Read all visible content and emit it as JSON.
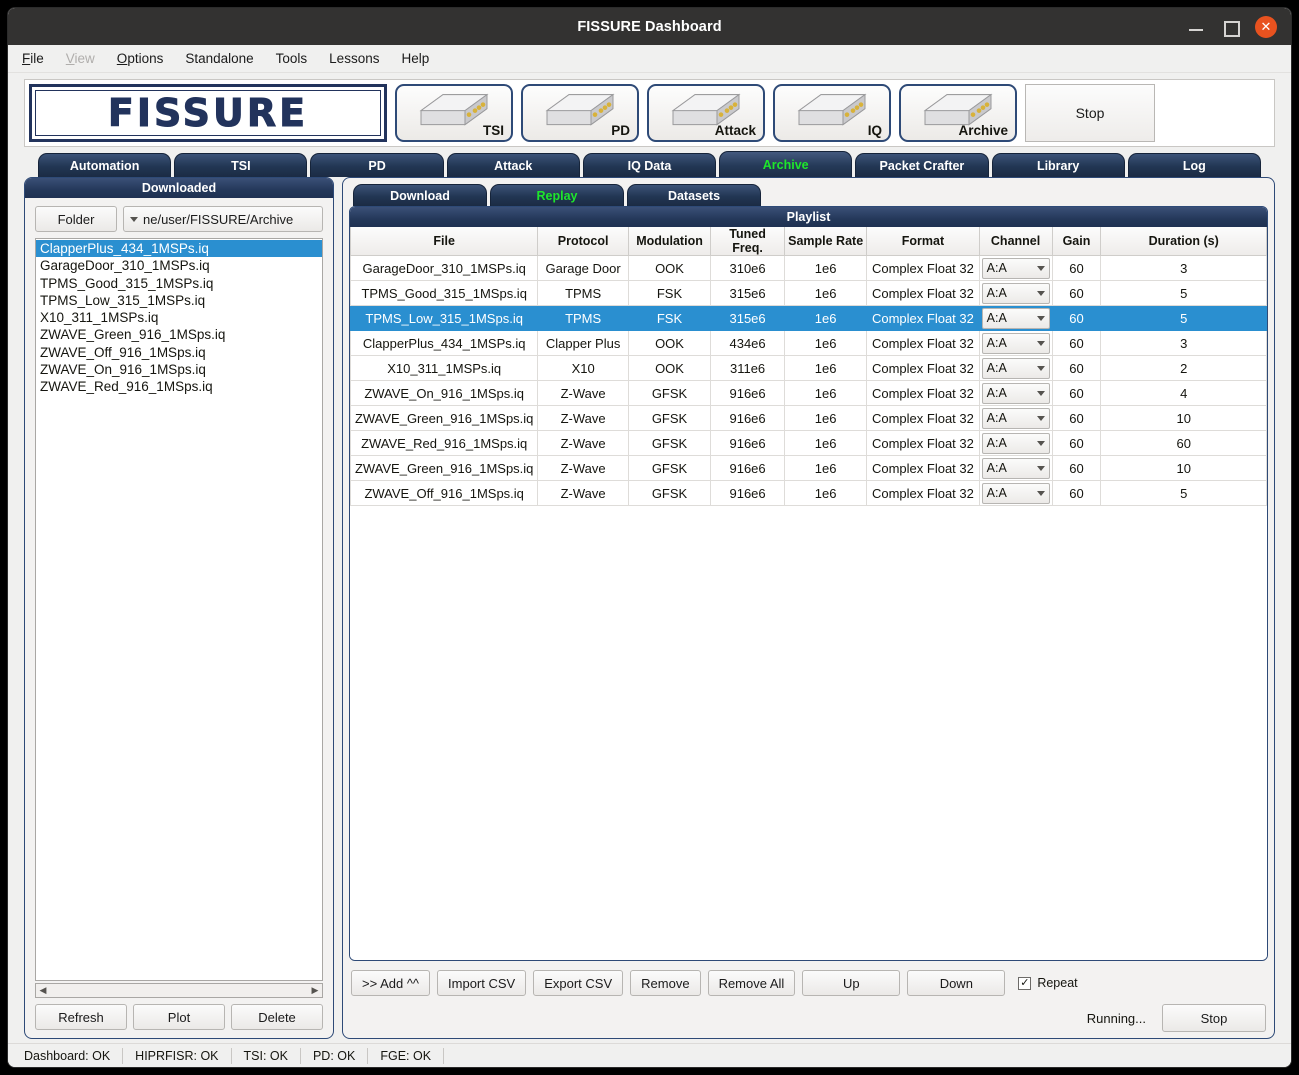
{
  "window": {
    "title": "FISSURE Dashboard",
    "minimize_icon": "minimize-icon",
    "maximize_icon": "maximize-icon",
    "close_icon": "close-icon",
    "close_glyph": "✕"
  },
  "menubar": {
    "items": [
      {
        "label": "File",
        "mnemonic": "F",
        "disabled": false
      },
      {
        "label": "View",
        "mnemonic": "V",
        "disabled": true
      },
      {
        "label": "Options",
        "mnemonic": "O",
        "disabled": false
      },
      {
        "label": "Standalone",
        "mnemonic": "",
        "disabled": false
      },
      {
        "label": "Tools",
        "mnemonic": "",
        "disabled": false
      },
      {
        "label": "Lessons",
        "mnemonic": "",
        "disabled": false
      },
      {
        "label": "Help",
        "mnemonic": "",
        "disabled": false
      }
    ]
  },
  "toolbar": {
    "logo_text": "FISSURE",
    "devices": [
      {
        "label": "TSI",
        "icon": "sdr-device-icon"
      },
      {
        "label": "PD",
        "icon": "sdr-device-icon"
      },
      {
        "label": "Attack",
        "icon": "sdr-device-icon"
      },
      {
        "label": "IQ",
        "icon": "sdr-device-icon"
      },
      {
        "label": "Archive",
        "icon": "sdr-device-icon"
      }
    ],
    "stop_label": "Stop"
  },
  "main_tabs": {
    "active": "Archive",
    "items": [
      {
        "label": "Automation"
      },
      {
        "label": "TSI"
      },
      {
        "label": "PD"
      },
      {
        "label": "Attack"
      },
      {
        "label": "IQ Data"
      },
      {
        "label": "Archive"
      },
      {
        "label": "Packet Crafter"
      },
      {
        "label": "Library"
      },
      {
        "label": "Log"
      }
    ]
  },
  "downloaded_panel": {
    "header": "Downloaded",
    "folder_button": "Folder",
    "path_value": "ne/user/FISSURE/Archive",
    "files": [
      "ClapperPlus_434_1MSPs.iq",
      "GarageDoor_310_1MSPs.iq",
      "TPMS_Good_315_1MSPs.iq",
      "TPMS_Low_315_1MSPs.iq",
      "X10_311_1MSPs.iq",
      "ZWAVE_Green_916_1MSps.iq",
      "ZWAVE_Off_916_1MSps.iq",
      "ZWAVE_On_916_1MSps.iq",
      "ZWAVE_Red_916_1MSps.iq"
    ],
    "selected_index": 0,
    "buttons": [
      {
        "label": "Refresh"
      },
      {
        "label": "Plot"
      },
      {
        "label": "Delete"
      }
    ]
  },
  "sub_tabs": {
    "active": "Replay",
    "items": [
      {
        "label": "Download"
      },
      {
        "label": "Replay"
      },
      {
        "label": "Datasets"
      }
    ]
  },
  "playlist": {
    "header": "Playlist",
    "columns": [
      "File",
      "Protocol",
      "Modulation",
      "Tuned Freq.",
      "Sample Rate",
      "Format",
      "Channel",
      "Gain",
      "Duration (s)"
    ],
    "selected_index": 2,
    "rows": [
      {
        "file": "GarageDoor_310_1MSPs.iq",
        "protocol": "Garage Door",
        "modulation": "OOK",
        "tuned_freq": "310e6",
        "sample_rate": "1e6",
        "format": "Complex Float 32",
        "channel": "A:A",
        "gain": "60",
        "duration": "3"
      },
      {
        "file": "TPMS_Good_315_1MSps.iq",
        "protocol": "TPMS",
        "modulation": "FSK",
        "tuned_freq": "315e6",
        "sample_rate": "1e6",
        "format": "Complex Float 32",
        "channel": "A:A",
        "gain": "60",
        "duration": "5"
      },
      {
        "file": "TPMS_Low_315_1MSps.iq",
        "protocol": "TPMS",
        "modulation": "FSK",
        "tuned_freq": "315e6",
        "sample_rate": "1e6",
        "format": "Complex Float 32",
        "channel": "A:A",
        "gain": "60",
        "duration": "5"
      },
      {
        "file": "ClapperPlus_434_1MSPs.iq",
        "protocol": "Clapper Plus",
        "modulation": "OOK",
        "tuned_freq": "434e6",
        "sample_rate": "1e6",
        "format": "Complex Float 32",
        "channel": "A:A",
        "gain": "60",
        "duration": "3"
      },
      {
        "file": "X10_311_1MSPs.iq",
        "protocol": "X10",
        "modulation": "OOK",
        "tuned_freq": "311e6",
        "sample_rate": "1e6",
        "format": "Complex Float 32",
        "channel": "A:A",
        "gain": "60",
        "duration": "2"
      },
      {
        "file": "ZWAVE_On_916_1MSps.iq",
        "protocol": "Z-Wave",
        "modulation": "GFSK",
        "tuned_freq": "916e6",
        "sample_rate": "1e6",
        "format": "Complex Float 32",
        "channel": "A:A",
        "gain": "60",
        "duration": "4"
      },
      {
        "file": "ZWAVE_Green_916_1MSps.iq",
        "protocol": "Z-Wave",
        "modulation": "GFSK",
        "tuned_freq": "916e6",
        "sample_rate": "1e6",
        "format": "Complex Float 32",
        "channel": "A:A",
        "gain": "60",
        "duration": "10"
      },
      {
        "file": "ZWAVE_Red_916_1MSps.iq",
        "protocol": "Z-Wave",
        "modulation": "GFSK",
        "tuned_freq": "916e6",
        "sample_rate": "1e6",
        "format": "Complex Float 32",
        "channel": "A:A",
        "gain": "60",
        "duration": "60"
      },
      {
        "file": "ZWAVE_Green_916_1MSps.iq",
        "protocol": "Z-Wave",
        "modulation": "GFSK",
        "tuned_freq": "916e6",
        "sample_rate": "1e6",
        "format": "Complex Float 32",
        "channel": "A:A",
        "gain": "60",
        "duration": "10"
      },
      {
        "file": "ZWAVE_Off_916_1MSps.iq",
        "protocol": "Z-Wave",
        "modulation": "GFSK",
        "tuned_freq": "916e6",
        "sample_rate": "1e6",
        "format": "Complex Float 32",
        "channel": "A:A",
        "gain": "60",
        "duration": "5"
      }
    ],
    "buttons": [
      {
        "label": ">> Add ^^"
      },
      {
        "label": "Import CSV"
      },
      {
        "label": "Export CSV"
      },
      {
        "label": "Remove"
      },
      {
        "label": "Remove All"
      },
      {
        "label": "Up"
      },
      {
        "label": "Down"
      }
    ],
    "repeat_label": "Repeat",
    "repeat_checked": true,
    "repeat_glyph": "✓",
    "running_label": "Running...",
    "stop_label": "Stop"
  },
  "statusbar": {
    "items": [
      {
        "label": "Dashboard: OK"
      },
      {
        "label": "HIPRFISR: OK"
      },
      {
        "label": "TSI: OK"
      },
      {
        "label": "PD: OK"
      },
      {
        "label": "FGE: OK"
      }
    ]
  },
  "colors": {
    "accent_blue": "#2a8fd0",
    "tab_navy": "#22335c",
    "active_tab_text": "#1ee62b",
    "close_button": "#e8521f"
  }
}
